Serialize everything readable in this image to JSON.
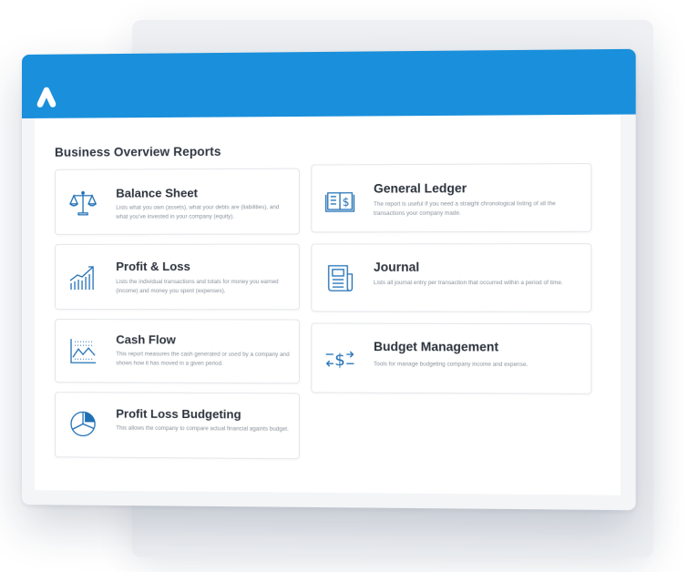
{
  "section_title": "Business Overview Reports",
  "reports_left": [
    {
      "title": "Balance Sheet",
      "description": "Lists what you own (assets), what your debts are (liabilities), and what you've invested in your company (equity).",
      "icon": "scales-icon"
    },
    {
      "title": "Profit & Loss",
      "description": "Lists the individual transactions and totals for money you earned (income) and money you spent (expenses).",
      "icon": "growth-chart-icon"
    },
    {
      "title": "Cash Flow",
      "description": "This report measures the cash generated or used by a company and shows how it has moved in a given period.",
      "icon": "line-chart-icon"
    },
    {
      "title": "Profit Loss Budgeting",
      "description": "This allows the company to compare actual financial againts budget.",
      "icon": "pie-chart-icon"
    }
  ],
  "reports_right": [
    {
      "title": "General Ledger",
      "description": "The report is useful if you need a straight chronological listing of all the transactions your company made.",
      "icon": "ledger-book-icon"
    },
    {
      "title": "Journal",
      "description": "Lists all journal entry per transaction that occurred within a period of time.",
      "icon": "journal-icon"
    },
    {
      "title": "Budget Management",
      "description": "Tools for manage budgeting company income and expense.",
      "icon": "dollar-exchange-icon"
    }
  ],
  "colors": {
    "accent": "#1a8fdb",
    "icon": "#1f6fb5",
    "title_text": "#2b323c",
    "body_text": "#8a929c"
  }
}
